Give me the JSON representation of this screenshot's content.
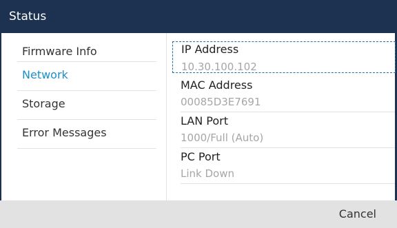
{
  "header": {
    "title": "Status"
  },
  "sidebar": {
    "items": [
      {
        "label": "Firmware Info"
      },
      {
        "label": "Network"
      },
      {
        "label": "Storage"
      },
      {
        "label": "Error Messages"
      }
    ],
    "active_index": 1
  },
  "details": {
    "fields": [
      {
        "label": "IP Address",
        "value": "10.30.100.102"
      },
      {
        "label": "MAC Address",
        "value": "00085D3E7691"
      },
      {
        "label": "LAN Port",
        "value": "1000/Full (Auto)"
      },
      {
        "label": "PC Port",
        "value": "Link Down"
      }
    ]
  },
  "footer": {
    "cancel_label": "Cancel"
  },
  "colors": {
    "titlebar_bg": "#1d3250",
    "active_item": "#1b8fc9",
    "value_text": "#a6a6a6",
    "footer_bg": "#e2e2e2"
  }
}
